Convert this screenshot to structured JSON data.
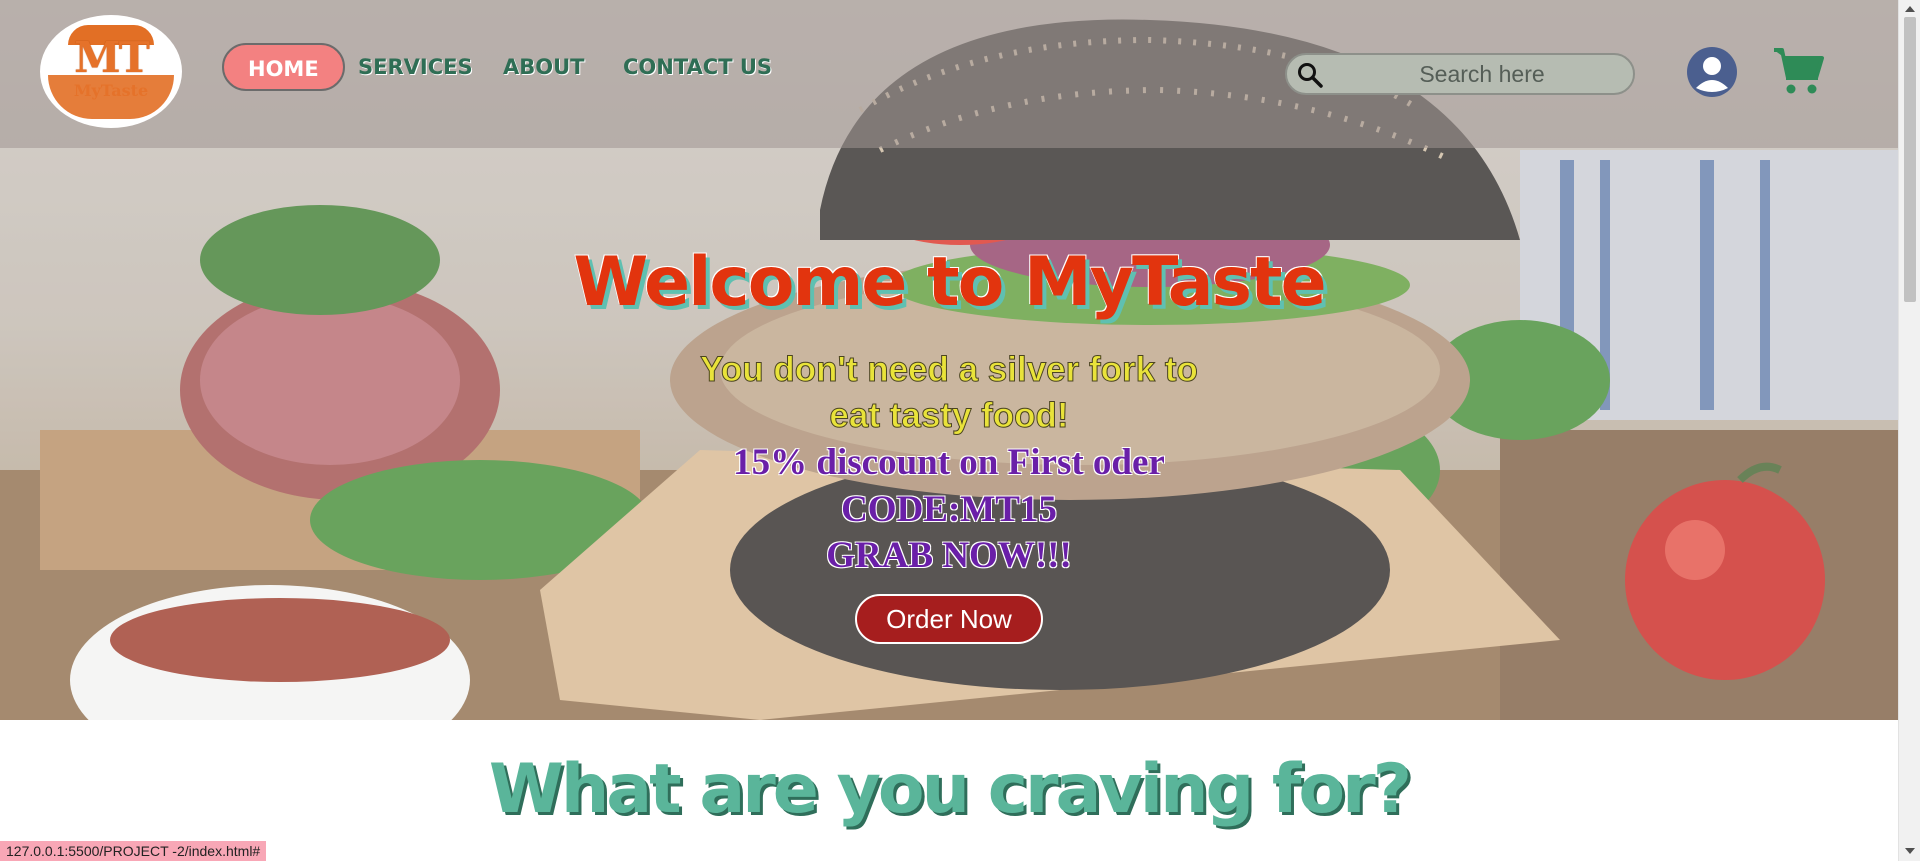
{
  "brand": {
    "logo_mark": "MT",
    "logo_name": "MyTaste"
  },
  "nav": {
    "items": [
      {
        "label": "HOME",
        "active": true
      },
      {
        "label": "SERVICES",
        "active": false
      },
      {
        "label": "ABOUT",
        "active": false
      },
      {
        "label": "CONTACT US",
        "active": false
      }
    ]
  },
  "search": {
    "placeholder": "Search here",
    "value": "",
    "icon": "search-icon"
  },
  "header_icons": {
    "user": "user-icon",
    "cart": "cart-icon"
  },
  "hero": {
    "title": "Welcome to MyTaste",
    "tagline_line1": "You don't need a silver fork to",
    "tagline_line2": "eat tasty food!",
    "promo_line1": "15% discount on First oder",
    "promo_line2": "CODE:MT15",
    "promo_line3": "GRAB NOW!!!",
    "cta_label": "Order Now"
  },
  "section": {
    "title": "What are you craving for?"
  },
  "status_bar": {
    "url": "127.0.0.1:5500/PROJECT -2/index.html#"
  },
  "colors": {
    "nav_active_bg": "#f38181",
    "nav_text": "#2f6e55",
    "hero_title": "#e2340e",
    "hero_title_shadow": "#5fc0b1",
    "tagline": "#e9e33a",
    "promo": "#6a1fa8",
    "cta_bg": "#a61e1e",
    "section_title": "#5ab59a",
    "cart": "#2e8b57",
    "user": "#4b5f8f"
  }
}
